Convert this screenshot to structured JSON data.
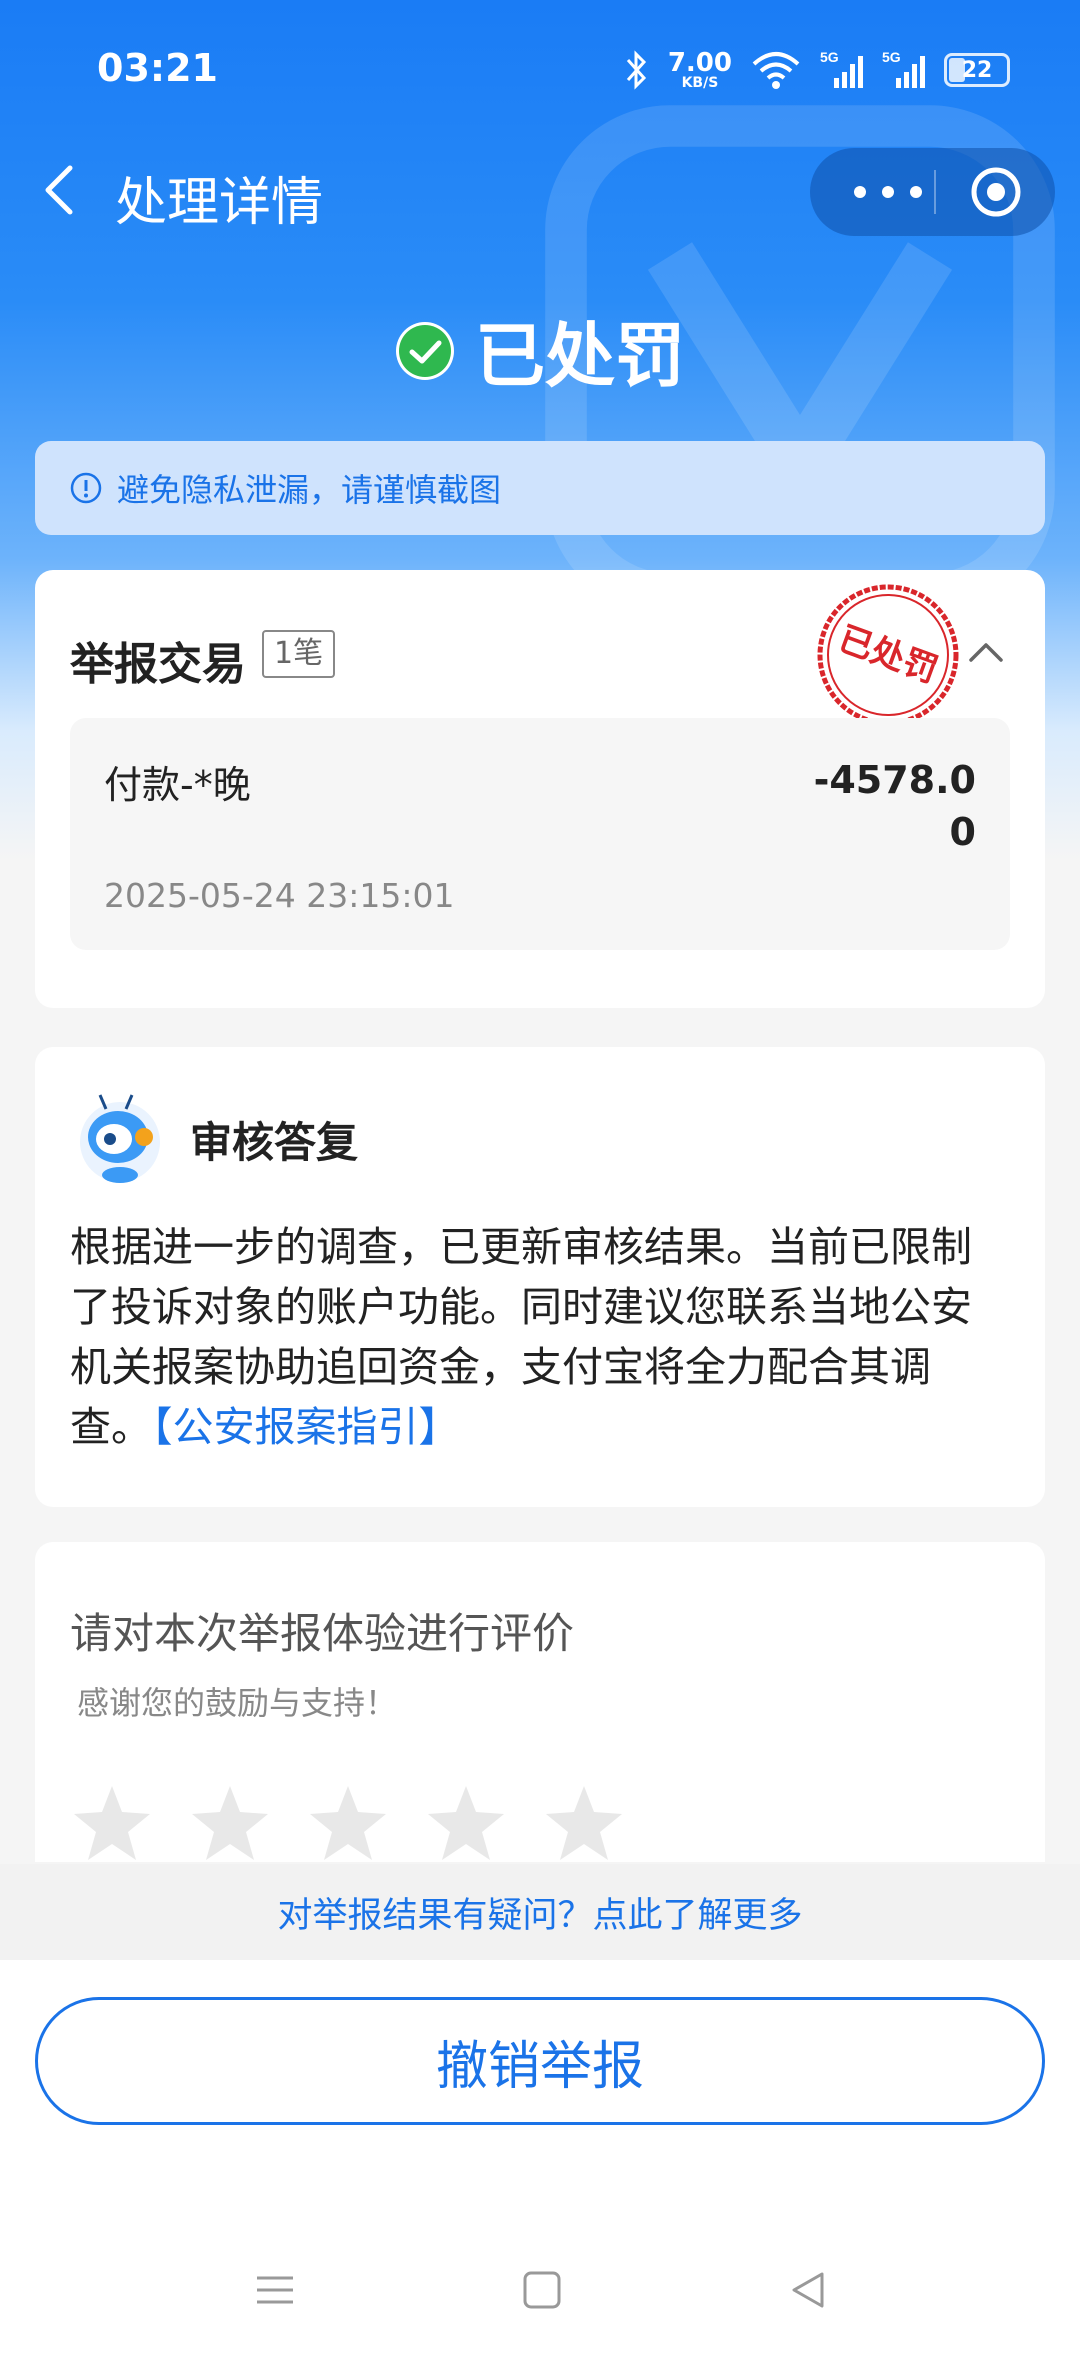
{
  "status_bar": {
    "time": "03:21",
    "net_speed": "7.00",
    "net_speed_unit": "KB/S",
    "battery": "22"
  },
  "nav": {
    "title": "处理详情"
  },
  "result": {
    "status": "已处罚"
  },
  "notice": {
    "text": "避免隐私泄漏，请谨慎截图"
  },
  "report": {
    "title": "举报交易",
    "count": "1笔",
    "stamp": "已处罚",
    "transaction": {
      "name": "付款-*晚",
      "amount": "-4578.00",
      "date": "2025-05-24 23:15:01"
    }
  },
  "review": {
    "title": "审核答复",
    "body": "根据进一步的调查，已更新审核结果。当前已限制了投诉对象的账户功能。同时建议您联系当地公安机关报案协助追回资金，支付宝将全力配合其调查。",
    "link": "【公安报案指引】"
  },
  "rating": {
    "title": "请对本次举报体验进行评价",
    "subtitle": "感谢您的鼓励与支持！",
    "stars_selected": 0,
    "stars_total": 5
  },
  "footer": {
    "question": "对举报结果有疑问？点此了解更多",
    "revoke_button": "撤销举报"
  },
  "colors": {
    "brand_blue": "#1a73e8",
    "success_green": "#2fb84f",
    "stamp_red": "#d9262b"
  }
}
